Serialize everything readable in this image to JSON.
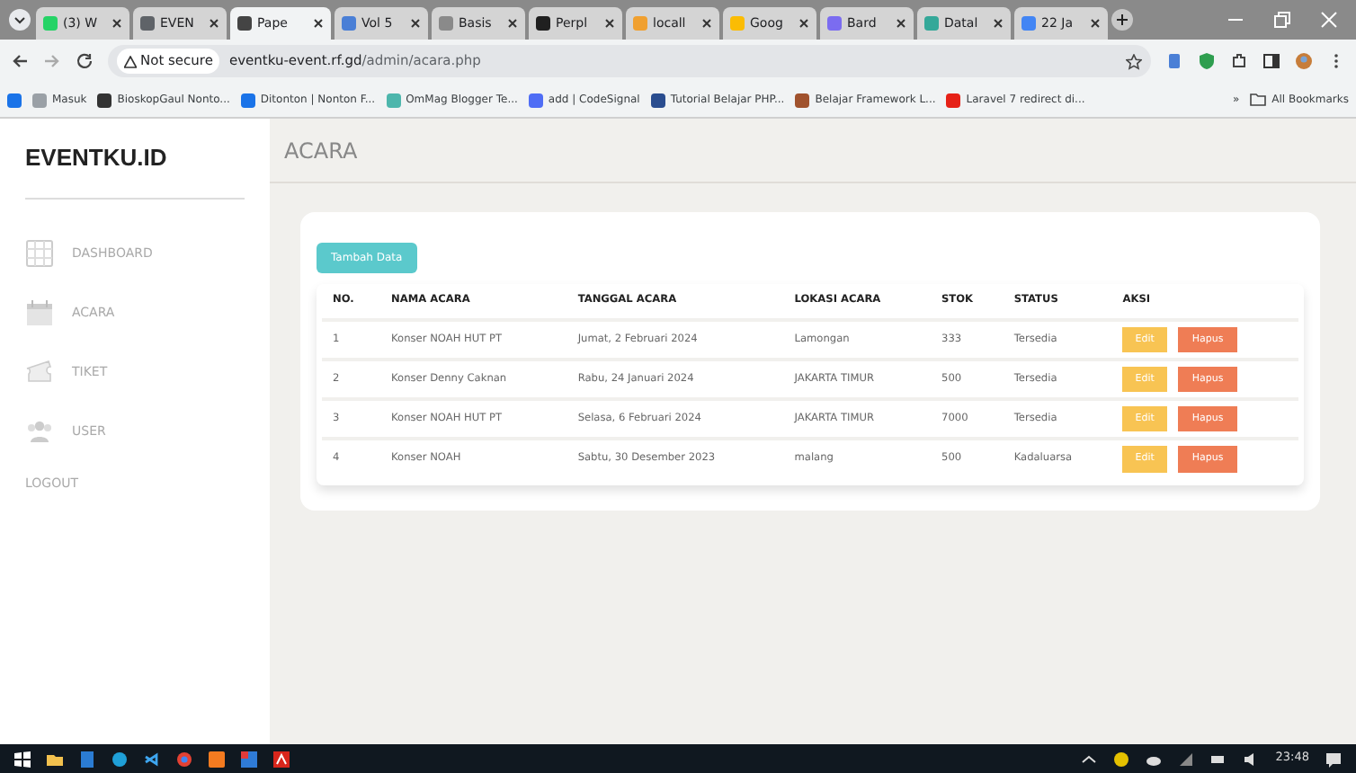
{
  "browser": {
    "tabs": [
      {
        "title": "(3) W",
        "selected": false,
        "color": "#25d366"
      },
      {
        "title": "EVEN",
        "selected": false,
        "color": "#5f6368"
      },
      {
        "title": "Pape",
        "selected": true,
        "color": "#444444"
      },
      {
        "title": "Vol 5",
        "selected": false,
        "color": "#4a7fd6"
      },
      {
        "title": "Basis",
        "selected": false,
        "color": "#8a8a8a"
      },
      {
        "title": "Perpl",
        "selected": false,
        "color": "#202020"
      },
      {
        "title": "locall",
        "selected": false,
        "color": "#f0a030"
      },
      {
        "title": "Goog",
        "selected": false,
        "color": "#fbbc04"
      },
      {
        "title": "Bard",
        "selected": false,
        "color": "#7b6cf0"
      },
      {
        "title": "Datal",
        "selected": false,
        "color": "#34a899"
      },
      {
        "title": "22 Ja",
        "selected": false,
        "color": "#4285f4"
      }
    ],
    "security": "Not secure",
    "url_host": "eventku-event.rf.gd",
    "url_path": "/admin/acara.php",
    "bookmarks": [
      {
        "color": "#1a73e8"
      },
      {
        "title": "Masuk",
        "color": "#9aa0a6"
      },
      {
        "title": "BioskopGaul Nonto...",
        "color": "#333333"
      },
      {
        "title": "Ditonton | Nonton F...",
        "color": "#1a73e8"
      },
      {
        "title": "OmMag Blogger Te...",
        "color": "#4db6ac"
      },
      {
        "title": "add | CodeSignal",
        "color": "#4f6df5"
      },
      {
        "title": "Tutorial Belajar PHP...",
        "color": "#2a4d8f"
      },
      {
        "title": "Belajar Framework L...",
        "color": "#a0522d"
      },
      {
        "title": "Laravel 7 redirect di...",
        "color": "#e62117"
      }
    ],
    "bookmarks_overflow": "»",
    "all_bookmarks": "All Bookmarks"
  },
  "sidebar": {
    "brand": "EVENTKU.ID",
    "items": [
      {
        "label": "DASHBOARD",
        "kind": "grid"
      },
      {
        "label": "ACARA",
        "kind": "calendar"
      },
      {
        "label": "TIKET",
        "kind": "ticket"
      },
      {
        "label": "USER",
        "kind": "users"
      },
      {
        "label": "LOGOUT",
        "kind": "plain"
      }
    ]
  },
  "page_title": "ACARA",
  "add_button": "Tambah Data",
  "table": {
    "columns": [
      "NO.",
      "NAMA ACARA",
      "TANGGAL ACARA",
      "LOKASI ACARA",
      "STOK",
      "STATUS",
      "AKSI"
    ],
    "rows": [
      {
        "no": "1",
        "name": "Konser NOAH HUT PT",
        "date": "Jumat, 2 Februari 2024",
        "location": "Lamongan",
        "stock": "333",
        "status": "Tersedia",
        "edit": "Edit",
        "delete": "Hapus"
      },
      {
        "no": "2",
        "name": "Konser Denny Caknan",
        "date": "Rabu, 24 Januari 2024",
        "location": "JAKARTA TIMUR",
        "stock": "500",
        "status": "Tersedia",
        "edit": "Edit",
        "delete": "Hapus"
      },
      {
        "no": "3",
        "name": "Konser NOAH HUT PT",
        "date": "Selasa, 6 Februari 2024",
        "location": "JAKARTA TIMUR",
        "stock": "7000",
        "status": "Tersedia",
        "edit": "Edit",
        "delete": "Hapus"
      },
      {
        "no": "4",
        "name": "Konser NOAH",
        "date": "Sabtu, 30 Desember 2023",
        "location": "malang",
        "stock": "500",
        "status": "Kadaluarsa",
        "edit": "Edit",
        "delete": "Hapus"
      }
    ]
  },
  "taskbar": {
    "clock": "23:48"
  }
}
